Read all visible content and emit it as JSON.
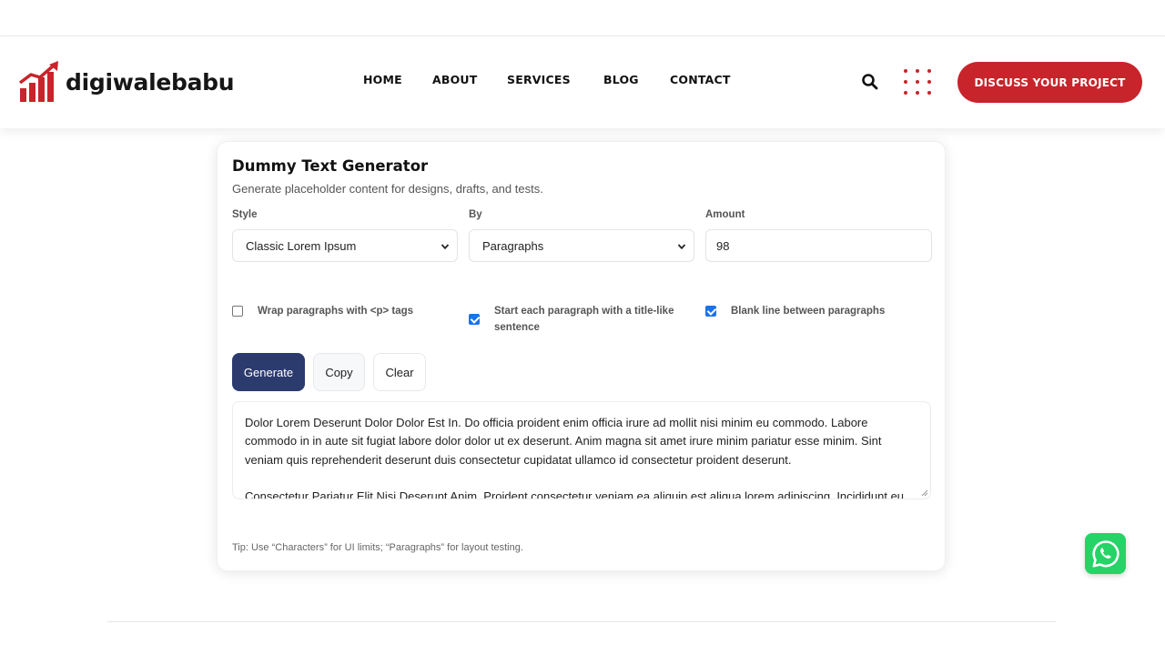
{
  "brand": {
    "name": "digiwalebabu",
    "accent": "#c8242b"
  },
  "nav": {
    "items": [
      "HOME",
      "ABOUT",
      "SERVICES",
      "BLOG",
      "CONTACT"
    ]
  },
  "header": {
    "search_icon": "search-icon",
    "menu_icon": "grid-dots-icon",
    "cta_label": "DISCUSS YOUR PROJECT"
  },
  "generator": {
    "title": "Dummy Text Generator",
    "subtitle": "Generate placeholder content for designs, drafts, and tests.",
    "style": {
      "label": "Style",
      "value": "Classic Lorem Ipsum"
    },
    "by": {
      "label": "By",
      "value": "Paragraphs"
    },
    "amount": {
      "label": "Amount",
      "value": "98"
    },
    "options": [
      {
        "label": "Wrap paragraphs with <p> tags",
        "checked": false
      },
      {
        "label": "Start each paragraph with a title-like sentence",
        "checked": true
      },
      {
        "label": "Blank line between paragraphs",
        "checked": true
      }
    ],
    "buttons": {
      "generate": "Generate",
      "copy": "Copy",
      "clear": "Clear"
    },
    "output": [
      "Dolor Lorem Deserunt Dolor Dolor Est In. Do officia proident enim officia irure ad mollit nisi minim eu commodo. Labore commodo in in aute sit fugiat labore dolor dolor ut ex deserunt. Anim magna sit amet irure minim pariatur esse minim. Sint veniam quis reprehenderit deserunt duis consectetur cupidatat ullamco id consectetur proident deserunt.",
      "Consectetur Pariatur Elit Nisi Deserunt Anim. Proident consectetur veniam ea aliquip est aliqua lorem adipiscing. Incididunt eu"
    ],
    "tip": "Tip: Use “Characters” for UI limits; “Paragraphs” for layout testing."
  },
  "floating": {
    "whatsapp_icon": "whatsapp-icon",
    "whatsapp_color": "#25d366"
  }
}
